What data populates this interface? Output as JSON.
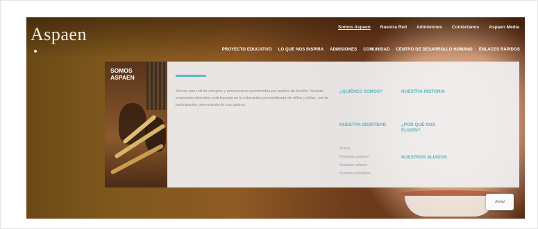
{
  "brand": {
    "logo_text": "Aspaen"
  },
  "top_nav": {
    "items": [
      {
        "label": "Somos Aspaen",
        "active": true
      },
      {
        "label": "Nuestra Red",
        "active": false
      },
      {
        "label": "Admisiones",
        "active": false
      },
      {
        "label": "Contáctanos",
        "active": false
      },
      {
        "label": "Aspaen Media",
        "active": false
      }
    ]
  },
  "main_nav": {
    "items": [
      "PROYECTO EDUCATIVO",
      "LO QUE NOS INSPIRA",
      "ADMISIONES",
      "COMUNIDAD",
      "CENTRO DE DESARROLLO HUMANO",
      "ENLACES RÁPIDOS"
    ]
  },
  "mega_menu": {
    "tile_title": "SOMOS ASPAEN",
    "intro": "Somos una red de colegios y preescolares promovidos por padres de familia. Nuestra propuesta educativa está basada en la educación personalizada de niños y niñas, con la participación permanente de sus padres.",
    "links": {
      "quienes_somos": "¿QUIÉNES SOMOS?",
      "nuestra_historia": "NUESTRA HISTORIA",
      "nuestra_identidad": "NUESTRA IDENTIDAD",
      "por_que_elegir": "¿POR QUÉ NOS ELIGEN?",
      "nuestros_aliados": "NUESTROS ALIADOS"
    },
    "identidad_sublinks": [
      "Misión",
      "Propósito superior",
      "Nuestros valores",
      "Nuestros principios"
    ]
  },
  "menu_button": {
    "label": "¡Hola!"
  },
  "colors": {
    "accent": "#56b4c2",
    "panel": "#f0f0f1",
    "nav_text": "#ffffff"
  }
}
